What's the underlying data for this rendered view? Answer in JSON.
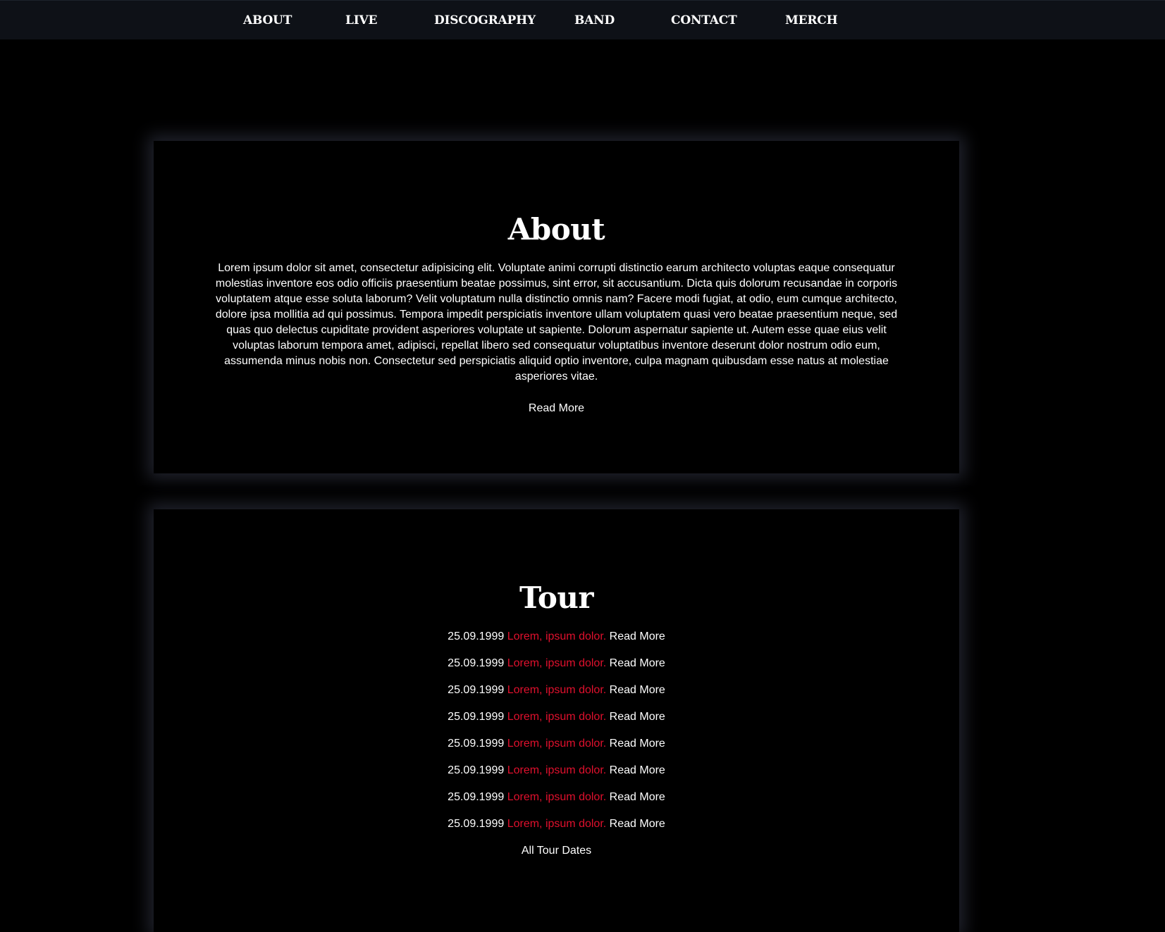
{
  "nav": {
    "items": [
      {
        "label": "ABOUT"
      },
      {
        "label": "LIVE"
      },
      {
        "label": "DISCOGRAPHY"
      },
      {
        "label": "BAND"
      },
      {
        "label": "CONTACT"
      },
      {
        "label": "MERCH"
      }
    ]
  },
  "about": {
    "title": "About",
    "body": "Lorem ipsum dolor sit amet, consectetur adipisicing elit. Voluptate animi corrupti distinctio earum architecto voluptas eaque consequatur molestias inventore eos odio officiis praesentium beatae possimus, sint error, sit accusantium. Dicta quis dolorum recusandae in corporis voluptatem atque esse soluta laborum? Velit voluptatum nulla distinctio omnis nam? Facere modi fugiat, at odio, eum cumque architecto, dolore ipsa mollitia ad qui possimus. Tempora impedit perspiciatis inventore ullam voluptatem quasi vero beatae praesentium neque, sed quas quo delectus cupiditate provident asperiores voluptate ut sapiente. Dolorum aspernatur sapiente ut. Autem esse quae eius velit voluptas laborum tempora amet, adipisci, repellat libero sed consequatur voluptatibus inventore deserunt dolor nostrum odio eum, assumenda minus nobis non. Consectetur sed perspiciatis aliquid optio inventore, culpa magnam quibusdam esse natus at molestiae asperiores vitae.",
    "read_more": "Read More"
  },
  "tour": {
    "title": "Tour",
    "dates": [
      {
        "date": "25.09.1999",
        "title": "Lorem, ipsum dolor.",
        "more": "Read More"
      },
      {
        "date": "25.09.1999",
        "title": "Lorem, ipsum dolor.",
        "more": "Read More"
      },
      {
        "date": "25.09.1999",
        "title": "Lorem, ipsum dolor.",
        "more": "Read More"
      },
      {
        "date": "25.09.1999",
        "title": "Lorem, ipsum dolor.",
        "more": "Read More"
      },
      {
        "date": "25.09.1999",
        "title": "Lorem, ipsum dolor.",
        "more": "Read More"
      },
      {
        "date": "25.09.1999",
        "title": "Lorem, ipsum dolor.",
        "more": "Read More"
      },
      {
        "date": "25.09.1999",
        "title": "Lorem, ipsum dolor.",
        "more": "Read More"
      },
      {
        "date": "25.09.1999",
        "title": "Lorem, ipsum dolor.",
        "more": "Read More"
      }
    ],
    "all_dates": "All Tour Dates"
  },
  "colors": {
    "background": "#000000",
    "navbar": "#0e1117",
    "accent_red": "#e0102d",
    "text": "#ffffff"
  }
}
